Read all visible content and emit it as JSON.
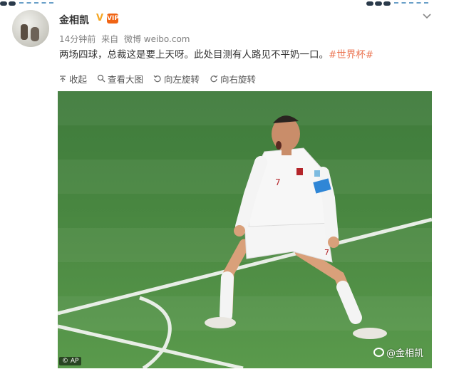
{
  "post": {
    "author": "金相凯",
    "time": "14分钟前",
    "source_prefix": "来自",
    "source": "微博 weibo.com",
    "text": "两场四球，总裁这是要上天呀。此处目测有人路见不平奶一口。",
    "hashtag": "#世界杯#",
    "badge_vip": "VIP"
  },
  "toolbar": {
    "collapse": "收起",
    "view_large": "查看大图",
    "rotate_left": "向左旋转",
    "rotate_right": "向右旋转"
  },
  "image": {
    "credit": "© AP",
    "watermark": "@金相凯",
    "jersey_number": "7"
  },
  "colors": {
    "hashtag": "#eb7350",
    "pitch": "#4e8c44",
    "verified_badge": "#f5a623"
  },
  "icons": [
    "collapse-icon",
    "magnifier-icon",
    "rotate-left-icon",
    "rotate-right-icon",
    "chevron-down-icon",
    "weibo-icon"
  ]
}
